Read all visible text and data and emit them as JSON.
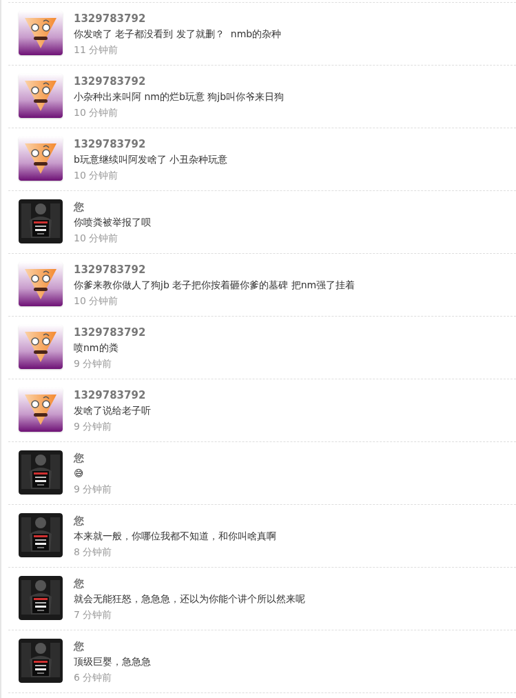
{
  "comments": [
    {
      "kind": "cartoon",
      "author": "1329783792",
      "text": "你发啥了 老子都没看到 发了就删？  nmb的杂种",
      "time": "11 分钟前"
    },
    {
      "kind": "cartoon",
      "author": "1329783792",
      "text": "小杂种出来叫阿 nm的烂b玩意 狗jb叫你爷来日狗",
      "time": "10 分钟前"
    },
    {
      "kind": "cartoon",
      "author": "1329783792",
      "text": "b玩意继续叫阿发啥了 小丑杂种玩意",
      "time": "10 分钟前"
    },
    {
      "author": "您",
      "text": "你喷粪被举报了呗",
      "time": "10 分钟前"
    },
    {
      "kind": "cartoon",
      "author": "1329783792",
      "text": "你爹来教你做人了狗jb 老子把你按着砸你爹的墓碑 把nm强了挂着",
      "time": "10 分钟前"
    },
    {
      "kind": "cartoon",
      "author": "1329783792",
      "text": "喷nm的粪",
      "time": "9 分钟前"
    },
    {
      "kind": "cartoon",
      "author": "1329783792",
      "text": "发啥了说给老子听",
      "time": "9 分钟前"
    },
    {
      "author": "您",
      "text": "😅",
      "time": "9 分钟前"
    },
    {
      "author": "您",
      "text": "本来就一般，你哪位我都不知道，和你叫啥真啊",
      "time": "8 分钟前"
    },
    {
      "author": "您",
      "text": "就会无能狂怒，急急急，还以为你能个讲个所以然来呢",
      "time": "7 分钟前"
    },
    {
      "author": "您",
      "text": "顶级巨婴，急急急",
      "time": "6 分钟前"
    }
  ]
}
